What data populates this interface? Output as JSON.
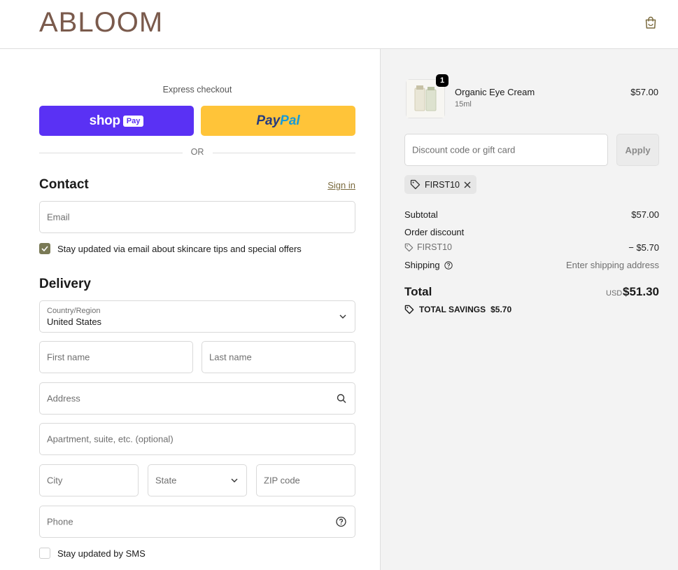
{
  "header": {
    "logo": "ABLOOM",
    "cart_icon": "shopping-bag-icon"
  },
  "express": {
    "label": "Express checkout",
    "shop_word": "shop",
    "shop_pay": "Pay",
    "paypal_1": "Pay",
    "paypal_2": "Pal",
    "or": "OR"
  },
  "contact": {
    "title": "Contact",
    "sign_in": "Sign in",
    "email_placeholder": "Email",
    "newsletter_label": "Stay updated via email about skincare tips and special offers",
    "newsletter_checked": true
  },
  "delivery": {
    "title": "Delivery",
    "country_label": "Country/Region",
    "country_value": "United States",
    "first_name": "First name",
    "last_name": "Last name",
    "address": "Address",
    "apartment": "Apartment, suite, etc. (optional)",
    "city": "City",
    "state": "State",
    "zip": "ZIP code",
    "phone": "Phone",
    "sms_label": "Stay updated by SMS",
    "sms_checked": false
  },
  "order": {
    "product_name": "Organic Eye Cream",
    "product_variant": "15ml",
    "product_price": "$57.00",
    "quantity": "1",
    "discount_placeholder": "Discount code or gift card",
    "apply_label": "Apply",
    "applied_code": "FIRST10",
    "subtotal_label": "Subtotal",
    "subtotal_value": "$57.00",
    "order_discount_label": "Order discount",
    "discount_code": "FIRST10",
    "discount_value": "− $5.70",
    "shipping_label": "Shipping",
    "shipping_value": "Enter shipping address",
    "total_label": "Total",
    "total_currency": "USD",
    "total_value": "$51.30",
    "savings_label": "TOTAL SAVINGS",
    "savings_value": "$5.70"
  },
  "colors": {
    "shop_pay": "#5a31f4",
    "paypal": "#ffc439",
    "logo": "#7a5a4c",
    "checkbox": "#7a7a56"
  }
}
